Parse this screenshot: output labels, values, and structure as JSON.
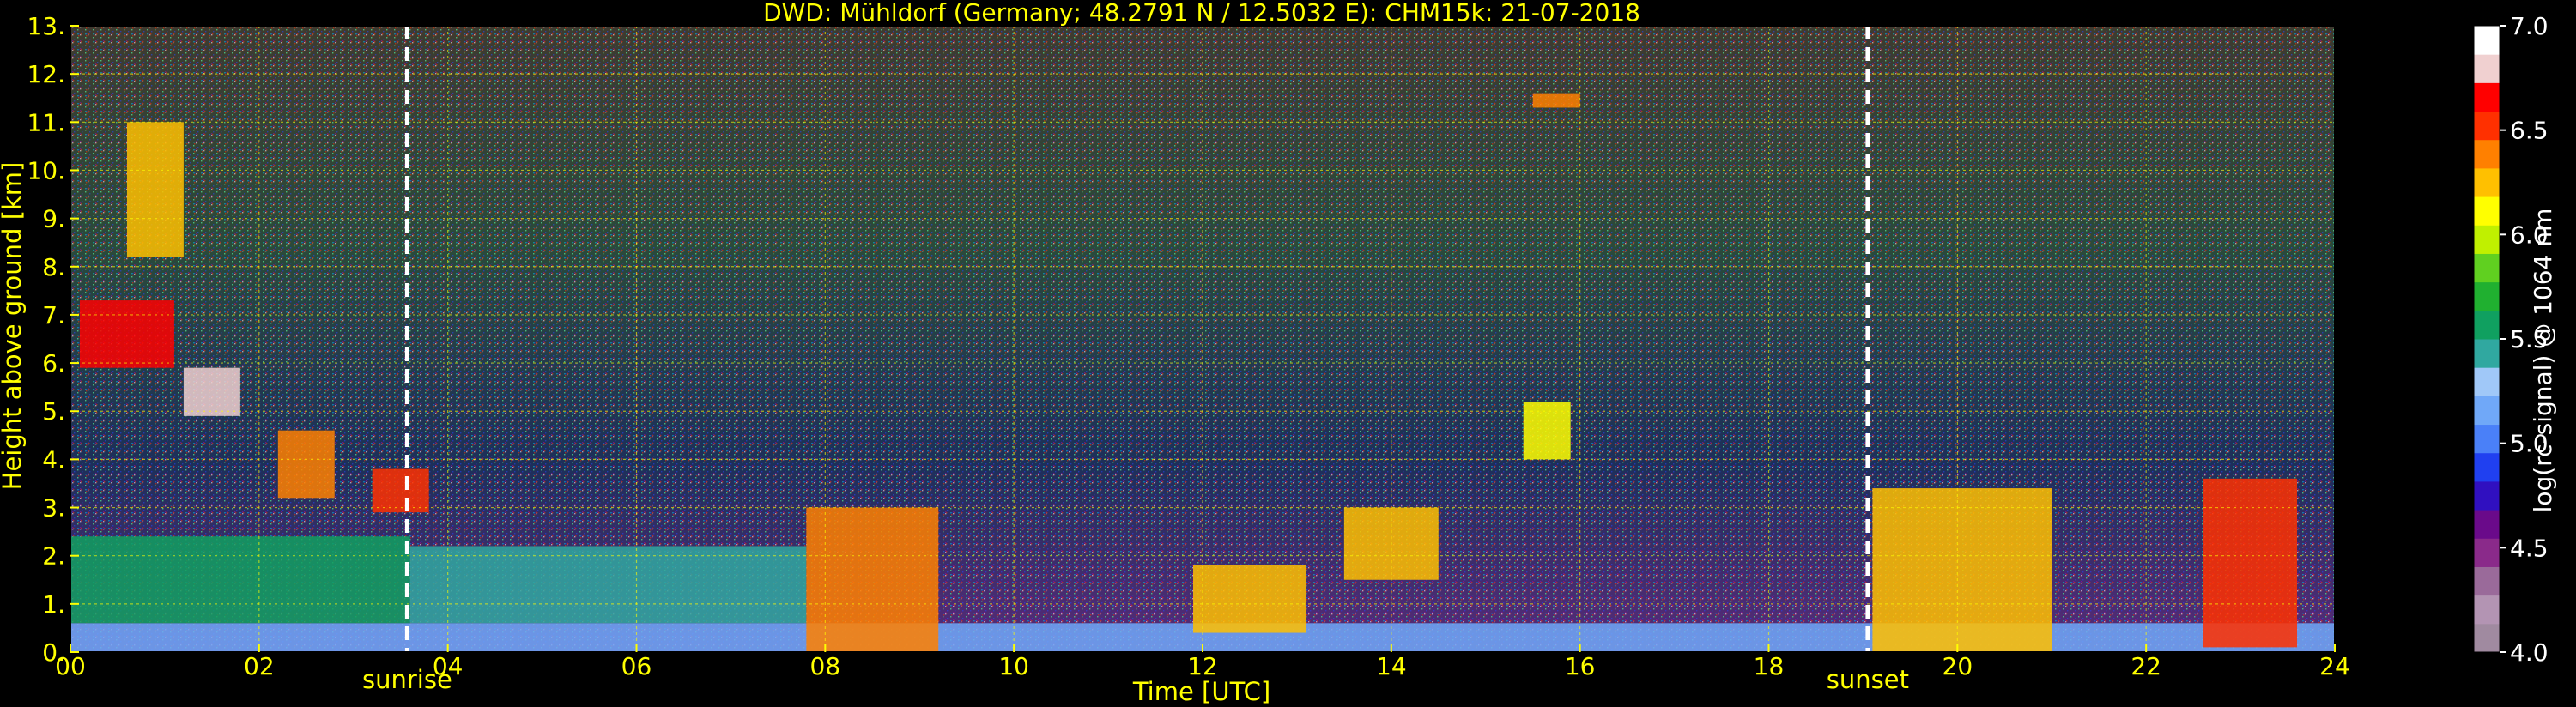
{
  "chart_data": {
    "type": "heatmap",
    "title": "DWD: Mühldorf (Germany; 48.2791 N / 12.5032 E):    CHM15k: 21-07-2018",
    "xlabel": "Time [UTC]",
    "ylabel": "Height above ground [km]",
    "xlim": [
      0,
      24
    ],
    "ylim": [
      0,
      13
    ],
    "x_ticks": [
      "00",
      "02",
      "04",
      "06",
      "08",
      "10",
      "12",
      "14",
      "16",
      "18",
      "20",
      "22",
      "24"
    ],
    "y_ticks": [
      "0.",
      "1.",
      "2.",
      "3.",
      "4.",
      "5.",
      "6.",
      "7.",
      "8.",
      "9.",
      "10.",
      "11.",
      "12.",
      "13."
    ],
    "grid": true,
    "annotations": [
      {
        "text": "sunrise",
        "x": 3.57
      },
      {
        "text": "sunset",
        "x": 19.05
      }
    ],
    "colorbar": {
      "label": "log(rc-signal) @ 1064 nm",
      "range": [
        4.0,
        7.0
      ],
      "ticks": [
        "4.0",
        "4.5",
        "5.0",
        "5.5",
        "6.0",
        "6.5",
        "7.0"
      ],
      "colors": [
        "#a08aa0",
        "#b394b3",
        "#9a6a9a",
        "#8a2a8a",
        "#6a0a8a",
        "#3010c0",
        "#2040f0",
        "#4a80f8",
        "#70a8f8",
        "#a0c8f8",
        "#30a8a0",
        "#10a060",
        "#20b030",
        "#60d020",
        "#c0f000",
        "#ffff00",
        "#ffc000",
        "#ff8000",
        "#ff3000",
        "#ff0000",
        "#f0d0d0",
        "#ffffff"
      ]
    },
    "features": [
      {
        "x0": 0.0,
        "x1": 24.0,
        "y0": 0.0,
        "y1": 0.6,
        "level": 5.1
      },
      {
        "x0": 0.0,
        "x1": 3.6,
        "y0": 0.6,
        "y1": 2.4,
        "level": 5.5
      },
      {
        "x0": 3.6,
        "x1": 7.8,
        "y0": 0.6,
        "y1": 2.2,
        "level": 5.45
      },
      {
        "x0": 7.8,
        "x1": 9.2,
        "y0": 0.0,
        "y1": 3.0,
        "level": 6.4
      },
      {
        "x0": 0.1,
        "x1": 1.1,
        "y0": 5.9,
        "y1": 7.3,
        "level": 6.7
      },
      {
        "x0": 1.2,
        "x1": 1.8,
        "y0": 4.9,
        "y1": 5.9,
        "level": 6.8
      },
      {
        "x0": 2.2,
        "x1": 2.8,
        "y0": 3.2,
        "y1": 4.6,
        "level": 6.4
      },
      {
        "x0": 0.6,
        "x1": 1.2,
        "y0": 8.2,
        "y1": 11.0,
        "level": 6.2
      },
      {
        "x0": 3.2,
        "x1": 3.8,
        "y0": 2.9,
        "y1": 3.8,
        "level": 6.5
      },
      {
        "x0": 11.9,
        "x1": 13.1,
        "y0": 0.4,
        "y1": 1.8,
        "level": 6.3
      },
      {
        "x0": 13.5,
        "x1": 14.5,
        "y0": 1.5,
        "y1": 3.0,
        "level": 6.2
      },
      {
        "x0": 15.4,
        "x1": 15.9,
        "y0": 4.0,
        "y1": 5.2,
        "level": 6.1
      },
      {
        "x0": 15.5,
        "x1": 16.0,
        "y0": 11.3,
        "y1": 11.6,
        "level": 6.4
      },
      {
        "x0": 19.1,
        "x1": 21.0,
        "y0": 0.0,
        "y1": 3.4,
        "level": 6.3
      },
      {
        "x0": 22.6,
        "x1": 23.6,
        "y0": 0.1,
        "y1": 3.6,
        "level": 6.5
      }
    ]
  }
}
